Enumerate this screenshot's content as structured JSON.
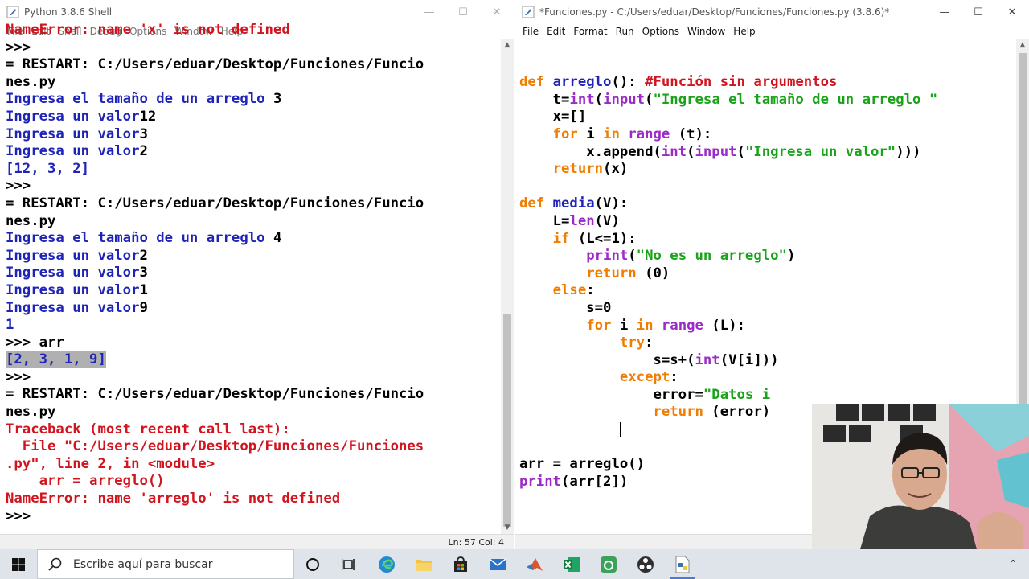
{
  "shell": {
    "title": "Python 3.8.6 Shell",
    "menu": [
      "File",
      "Edit",
      "Shell",
      "Debug",
      "Options",
      "Window",
      "Help"
    ],
    "status": "Ln: 57   Col: 4",
    "lines": [
      {
        "t": "NameError: name 'x' is not defined",
        "c": "red"
      },
      {
        "t": ">>> ",
        "c": "blk"
      },
      {
        "t": "= RESTART: C:/Users/eduar/Desktop/Funciones/Funcio",
        "c": "blk"
      },
      {
        "t": "nes.py",
        "c": "blk"
      },
      {
        "t": "Ingresa el tamaño de un arreglo ",
        "c": "blue",
        "tail": "3"
      },
      {
        "t": "Ingresa un valor",
        "c": "blue",
        "tail": "12"
      },
      {
        "t": "Ingresa un valor",
        "c": "blue",
        "tail": "3"
      },
      {
        "t": "Ingresa un valor",
        "c": "blue",
        "tail": "2"
      },
      {
        "t": "[12, 3, 2]",
        "c": "blue"
      },
      {
        "t": ">>> ",
        "c": "blk"
      },
      {
        "t": "= RESTART: C:/Users/eduar/Desktop/Funciones/Funcio",
        "c": "blk"
      },
      {
        "t": "nes.py",
        "c": "blk"
      },
      {
        "t": "Ingresa el tamaño de un arreglo ",
        "c": "blue",
        "tail": "4"
      },
      {
        "t": "Ingresa un valor",
        "c": "blue",
        "tail": "2"
      },
      {
        "t": "Ingresa un valor",
        "c": "blue",
        "tail": "3"
      },
      {
        "t": "Ingresa un valor",
        "c": "blue",
        "tail": "1"
      },
      {
        "t": "Ingresa un valor",
        "c": "blue",
        "tail": "9"
      },
      {
        "t": "1",
        "c": "blue"
      },
      {
        "t": ">>> arr",
        "c": "blk"
      },
      {
        "t": "[2, 3, 1, 9]",
        "c": "blue",
        "hl": true
      },
      {
        "t": ">>> ",
        "c": "blk"
      },
      {
        "t": "= RESTART: C:/Users/eduar/Desktop/Funciones/Funcio",
        "c": "blk"
      },
      {
        "t": "nes.py",
        "c": "blk"
      },
      {
        "t": "Traceback (most recent call last):",
        "c": "red"
      },
      {
        "t": "  File \"C:/Users/eduar/Desktop/Funciones/Funciones",
        "c": "red"
      },
      {
        "t": ".py\", line 2, in <module>",
        "c": "red"
      },
      {
        "t": "    arr = arreglo()",
        "c": "red"
      },
      {
        "t": "NameError: name 'arreglo' is not defined",
        "c": "red"
      },
      {
        "t": ">>> ",
        "c": "blk"
      }
    ]
  },
  "editor": {
    "title": "*Funciones.py - C:/Users/eduar/Desktop/Funciones/Funciones.py (3.8.6)*",
    "menu": [
      "File",
      "Edit",
      "Format",
      "Run",
      "Options",
      "Window",
      "Help"
    ],
    "lines": [
      [],
      [],
      [
        [
          "kw",
          "def "
        ],
        [
          "fn",
          "arreglo"
        ],
        [
          "blk",
          "(): "
        ],
        [
          "cm",
          "#Función sin argumentos"
        ]
      ],
      [
        [
          "blk",
          "    t="
        ],
        [
          "bi",
          "int"
        ],
        [
          "blk",
          "("
        ],
        [
          "bi",
          "input"
        ],
        [
          "blk",
          "("
        ],
        [
          "str",
          "\"Ingresa el tamaño de un arreglo \""
        ]
      ],
      [
        [
          "blk",
          "    x=[]"
        ]
      ],
      [
        [
          "kw",
          "    for "
        ],
        [
          "blk",
          "i "
        ],
        [
          "kw",
          "in "
        ],
        [
          "bi",
          "range "
        ],
        [
          "blk",
          "(t):"
        ]
      ],
      [
        [
          "blk",
          "        x.append("
        ],
        [
          "bi",
          "int"
        ],
        [
          "blk",
          "("
        ],
        [
          "bi",
          "input"
        ],
        [
          "blk",
          "("
        ],
        [
          "str",
          "\"Ingresa un valor\""
        ],
        [
          "blk",
          ")))"
        ]
      ],
      [
        [
          "kw",
          "    return"
        ],
        [
          "blk",
          "(x)"
        ]
      ],
      [],
      [
        [
          "kw",
          "def "
        ],
        [
          "fn",
          "media"
        ],
        [
          "blk",
          "(V):"
        ]
      ],
      [
        [
          "blk",
          "    L="
        ],
        [
          "bi",
          "len"
        ],
        [
          "blk",
          "(V)"
        ]
      ],
      [
        [
          "kw",
          "    if "
        ],
        [
          "blk",
          "(L<=1):"
        ]
      ],
      [
        [
          "blk",
          "        "
        ],
        [
          "bi",
          "print"
        ],
        [
          "blk",
          "("
        ],
        [
          "str",
          "\"No es un arreglo\""
        ],
        [
          "blk",
          ")"
        ]
      ],
      [
        [
          "kw",
          "        return "
        ],
        [
          "blk",
          "(0)"
        ]
      ],
      [
        [
          "kw",
          "    else"
        ],
        [
          "blk",
          ":"
        ]
      ],
      [
        [
          "blk",
          "        s=0"
        ]
      ],
      [
        [
          "kw",
          "        for "
        ],
        [
          "blk",
          "i "
        ],
        [
          "kw",
          "in "
        ],
        [
          "bi",
          "range "
        ],
        [
          "blk",
          "(L):"
        ]
      ],
      [
        [
          "kw",
          "            try"
        ],
        [
          "blk",
          ":"
        ]
      ],
      [
        [
          "blk",
          "                s=s+("
        ],
        [
          "bi",
          "int"
        ],
        [
          "blk",
          "(V[i]))"
        ]
      ],
      [
        [
          "kw",
          "            except"
        ],
        [
          "blk",
          ":"
        ]
      ],
      [
        [
          "blk",
          "                error="
        ],
        [
          "str",
          "\"Datos i"
        ]
      ],
      [
        [
          "kw",
          "                return "
        ],
        [
          "blk",
          "(error)"
        ]
      ],
      [
        [
          "caret",
          "            "
        ]
      ],
      [],
      [
        [
          "blk",
          "arr = arreglo()"
        ]
      ],
      [
        [
          "bi",
          "print"
        ],
        [
          "blk",
          "(arr[2])"
        ]
      ]
    ]
  },
  "taskbar": {
    "search_placeholder": "Escribe aquí para buscar"
  }
}
